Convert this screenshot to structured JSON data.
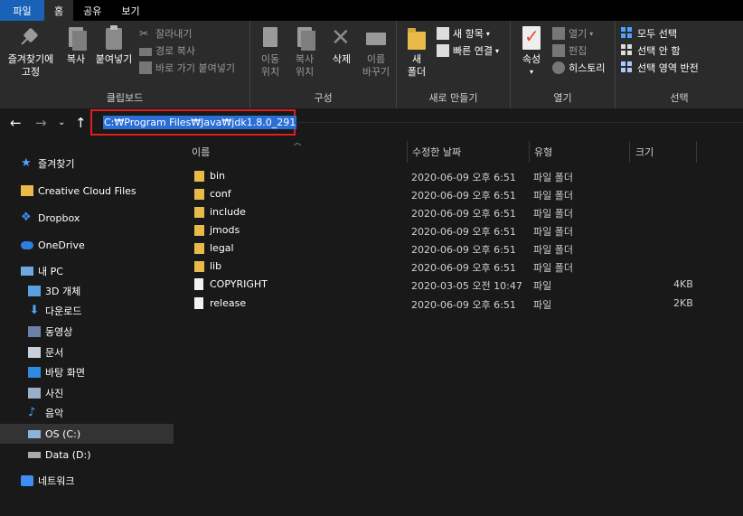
{
  "tabs": [
    "파일",
    "홈",
    "공유",
    "보기"
  ],
  "ribbon": {
    "clipboard": {
      "label": "클립보드",
      "pin_label_1": "즐겨찾기에",
      "pin_label_2": "고정",
      "copy": "복사",
      "paste": "붙여넣기",
      "cut": "잘라내기",
      "copy_path": "경로 복사",
      "paste_shortcut": "바로 가기 붙여넣기"
    },
    "organize": {
      "label": "구성",
      "move_1": "이동",
      "move_2": "위치",
      "copyto_1": "복사",
      "copyto_2": "위치",
      "delete": "삭제",
      "rename_1": "이름",
      "rename_2": "바꾸기"
    },
    "new": {
      "label": "새로 만들기",
      "new_folder_1": "새",
      "new_folder_2": "폴더",
      "new_item": "새 항목",
      "easy_access": "빠른 연결"
    },
    "open": {
      "label": "열기",
      "properties": "속성",
      "open": "열기",
      "edit": "편집",
      "history": "히스토리"
    },
    "select": {
      "label": "선택",
      "select_all": "모두 선택",
      "select_none": "선택 안 함",
      "invert": "선택 영역 반전"
    }
  },
  "address": {
    "path": "C:₩Program Files₩Java₩jdk1.8.0_291"
  },
  "sidebar": [
    {
      "label": "즐겨찾기",
      "icon": "star-icon"
    },
    {
      "label": "Creative Cloud Files",
      "icon": "creative-cloud-icon"
    },
    {
      "label": "Dropbox",
      "icon": "dropbox-icon"
    },
    {
      "label": "OneDrive",
      "icon": "onedrive-icon"
    },
    {
      "label": "내 PC",
      "icon": "pc-icon"
    },
    {
      "label": "3D 개체",
      "icon": "3d-objects-icon"
    },
    {
      "label": "다운로드",
      "icon": "download-icon"
    },
    {
      "label": "동영상",
      "icon": "video-icon"
    },
    {
      "label": "문서",
      "icon": "documents-icon"
    },
    {
      "label": "바탕 화면",
      "icon": "desktop-icon"
    },
    {
      "label": "사진",
      "icon": "pictures-icon"
    },
    {
      "label": "음악",
      "icon": "music-icon"
    },
    {
      "label": "OS (C:)",
      "icon": "drive-icon"
    },
    {
      "label": "Data (D:)",
      "icon": "drive-icon"
    },
    {
      "label": "네트워크",
      "icon": "network-icon"
    }
  ],
  "columns": {
    "name": "이름",
    "date": "수정한 날짜",
    "type": "유형",
    "size": "크기"
  },
  "files": [
    {
      "name": "bin",
      "date": "2020-06-09 오후 6:51",
      "type": "파일 폴더",
      "size": "",
      "kind": "folder"
    },
    {
      "name": "conf",
      "date": "2020-06-09 오후 6:51",
      "type": "파일 폴더",
      "size": "",
      "kind": "folder"
    },
    {
      "name": "include",
      "date": "2020-06-09 오후 6:51",
      "type": "파일 폴더",
      "size": "",
      "kind": "folder"
    },
    {
      "name": "jmods",
      "date": "2020-06-09 오후 6:51",
      "type": "파일 폴더",
      "size": "",
      "kind": "folder"
    },
    {
      "name": "legal",
      "date": "2020-06-09 오후 6:51",
      "type": "파일 폴더",
      "size": "",
      "kind": "folder"
    },
    {
      "name": "lib",
      "date": "2020-06-09 오후 6:51",
      "type": "파일 폴더",
      "size": "",
      "kind": "folder"
    },
    {
      "name": "COPYRIGHT",
      "date": "2020-03-05 오전 10:47",
      "type": "파일",
      "size": "4KB",
      "kind": "file"
    },
    {
      "name": "release",
      "date": "2020-06-09 오후 6:51",
      "type": "파일",
      "size": "2KB",
      "kind": "file"
    }
  ],
  "colors": {
    "file_tab": "#1a62b8",
    "highlight_border": "#e01e1e",
    "selection": "#2a6fd6"
  }
}
